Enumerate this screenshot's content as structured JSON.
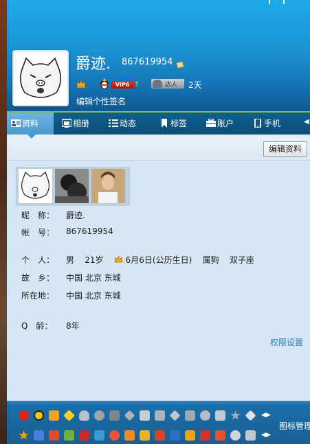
{
  "profile": {
    "nickname": "爵迹.",
    "qq_number": "867619954",
    "vip_label": "VIP6",
    "daren_label": "达人",
    "daren_days": "2天",
    "signature": "编辑个性签名"
  },
  "tabs": [
    {
      "label": "资料",
      "icon": "profile-card-icon"
    },
    {
      "label": "相册",
      "icon": "photo-album-icon"
    },
    {
      "label": "动态",
      "icon": "feed-list-icon"
    },
    {
      "label": "标签",
      "icon": "bookmark-icon"
    },
    {
      "label": "账户",
      "icon": "wallet-icon"
    },
    {
      "label": "手机",
      "icon": "phone-icon"
    }
  ],
  "toolbar": {
    "edit_label": "编辑资料"
  },
  "info": {
    "nickname_label": "昵　称：",
    "nickname_value": "爵迹.",
    "account_label": "帐　号：",
    "account_value": "867619954",
    "person_label": "个　人：",
    "gender": "男",
    "age": "21岁",
    "birthday": "6月6日(公历生日)",
    "zodiac": "属狗",
    "constellation": "双子座",
    "hometown_label": "故　乡：",
    "hometown_value": "中国 北京 东城",
    "location_label": "所在地：",
    "location_value": "中国 北京 东城",
    "qage_label": "Q　龄：",
    "qage_value": "8年"
  },
  "permission_link": "权限设置",
  "icon_manage_label": "图标管理",
  "colors": {
    "header_top": "#1ea9e8",
    "tab_bar": "#0b4f78",
    "accent_green": "#7bc143",
    "content_bg": "#d6e6f2",
    "link": "#2f7fc2"
  }
}
